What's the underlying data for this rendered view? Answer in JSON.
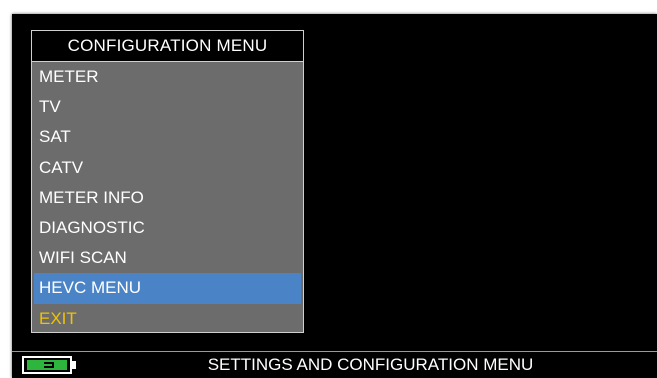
{
  "menu": {
    "title": "CONFIGURATION MENU",
    "items": [
      {
        "label": "METER",
        "selected": false
      },
      {
        "label": "TV",
        "selected": false
      },
      {
        "label": "SAT",
        "selected": false
      },
      {
        "label": "CATV",
        "selected": false
      },
      {
        "label": "METER INFO",
        "selected": false
      },
      {
        "label": "DIAGNOSTIC",
        "selected": false
      },
      {
        "label": "WIFI SCAN",
        "selected": false
      },
      {
        "label": "HEVC MENU",
        "selected": true
      },
      {
        "label": "EXIT",
        "selected": false
      }
    ]
  },
  "status_bar": {
    "battery_icon": "battery-charging-icon",
    "text": "SETTINGS AND CONFIGURATION MENU"
  },
  "colors": {
    "menu_background": "#6c6c6c",
    "selection": "#4a84c6",
    "exit_text": "#f1c200",
    "battery_fill": "#2db53d",
    "screen_background": "#000000"
  }
}
